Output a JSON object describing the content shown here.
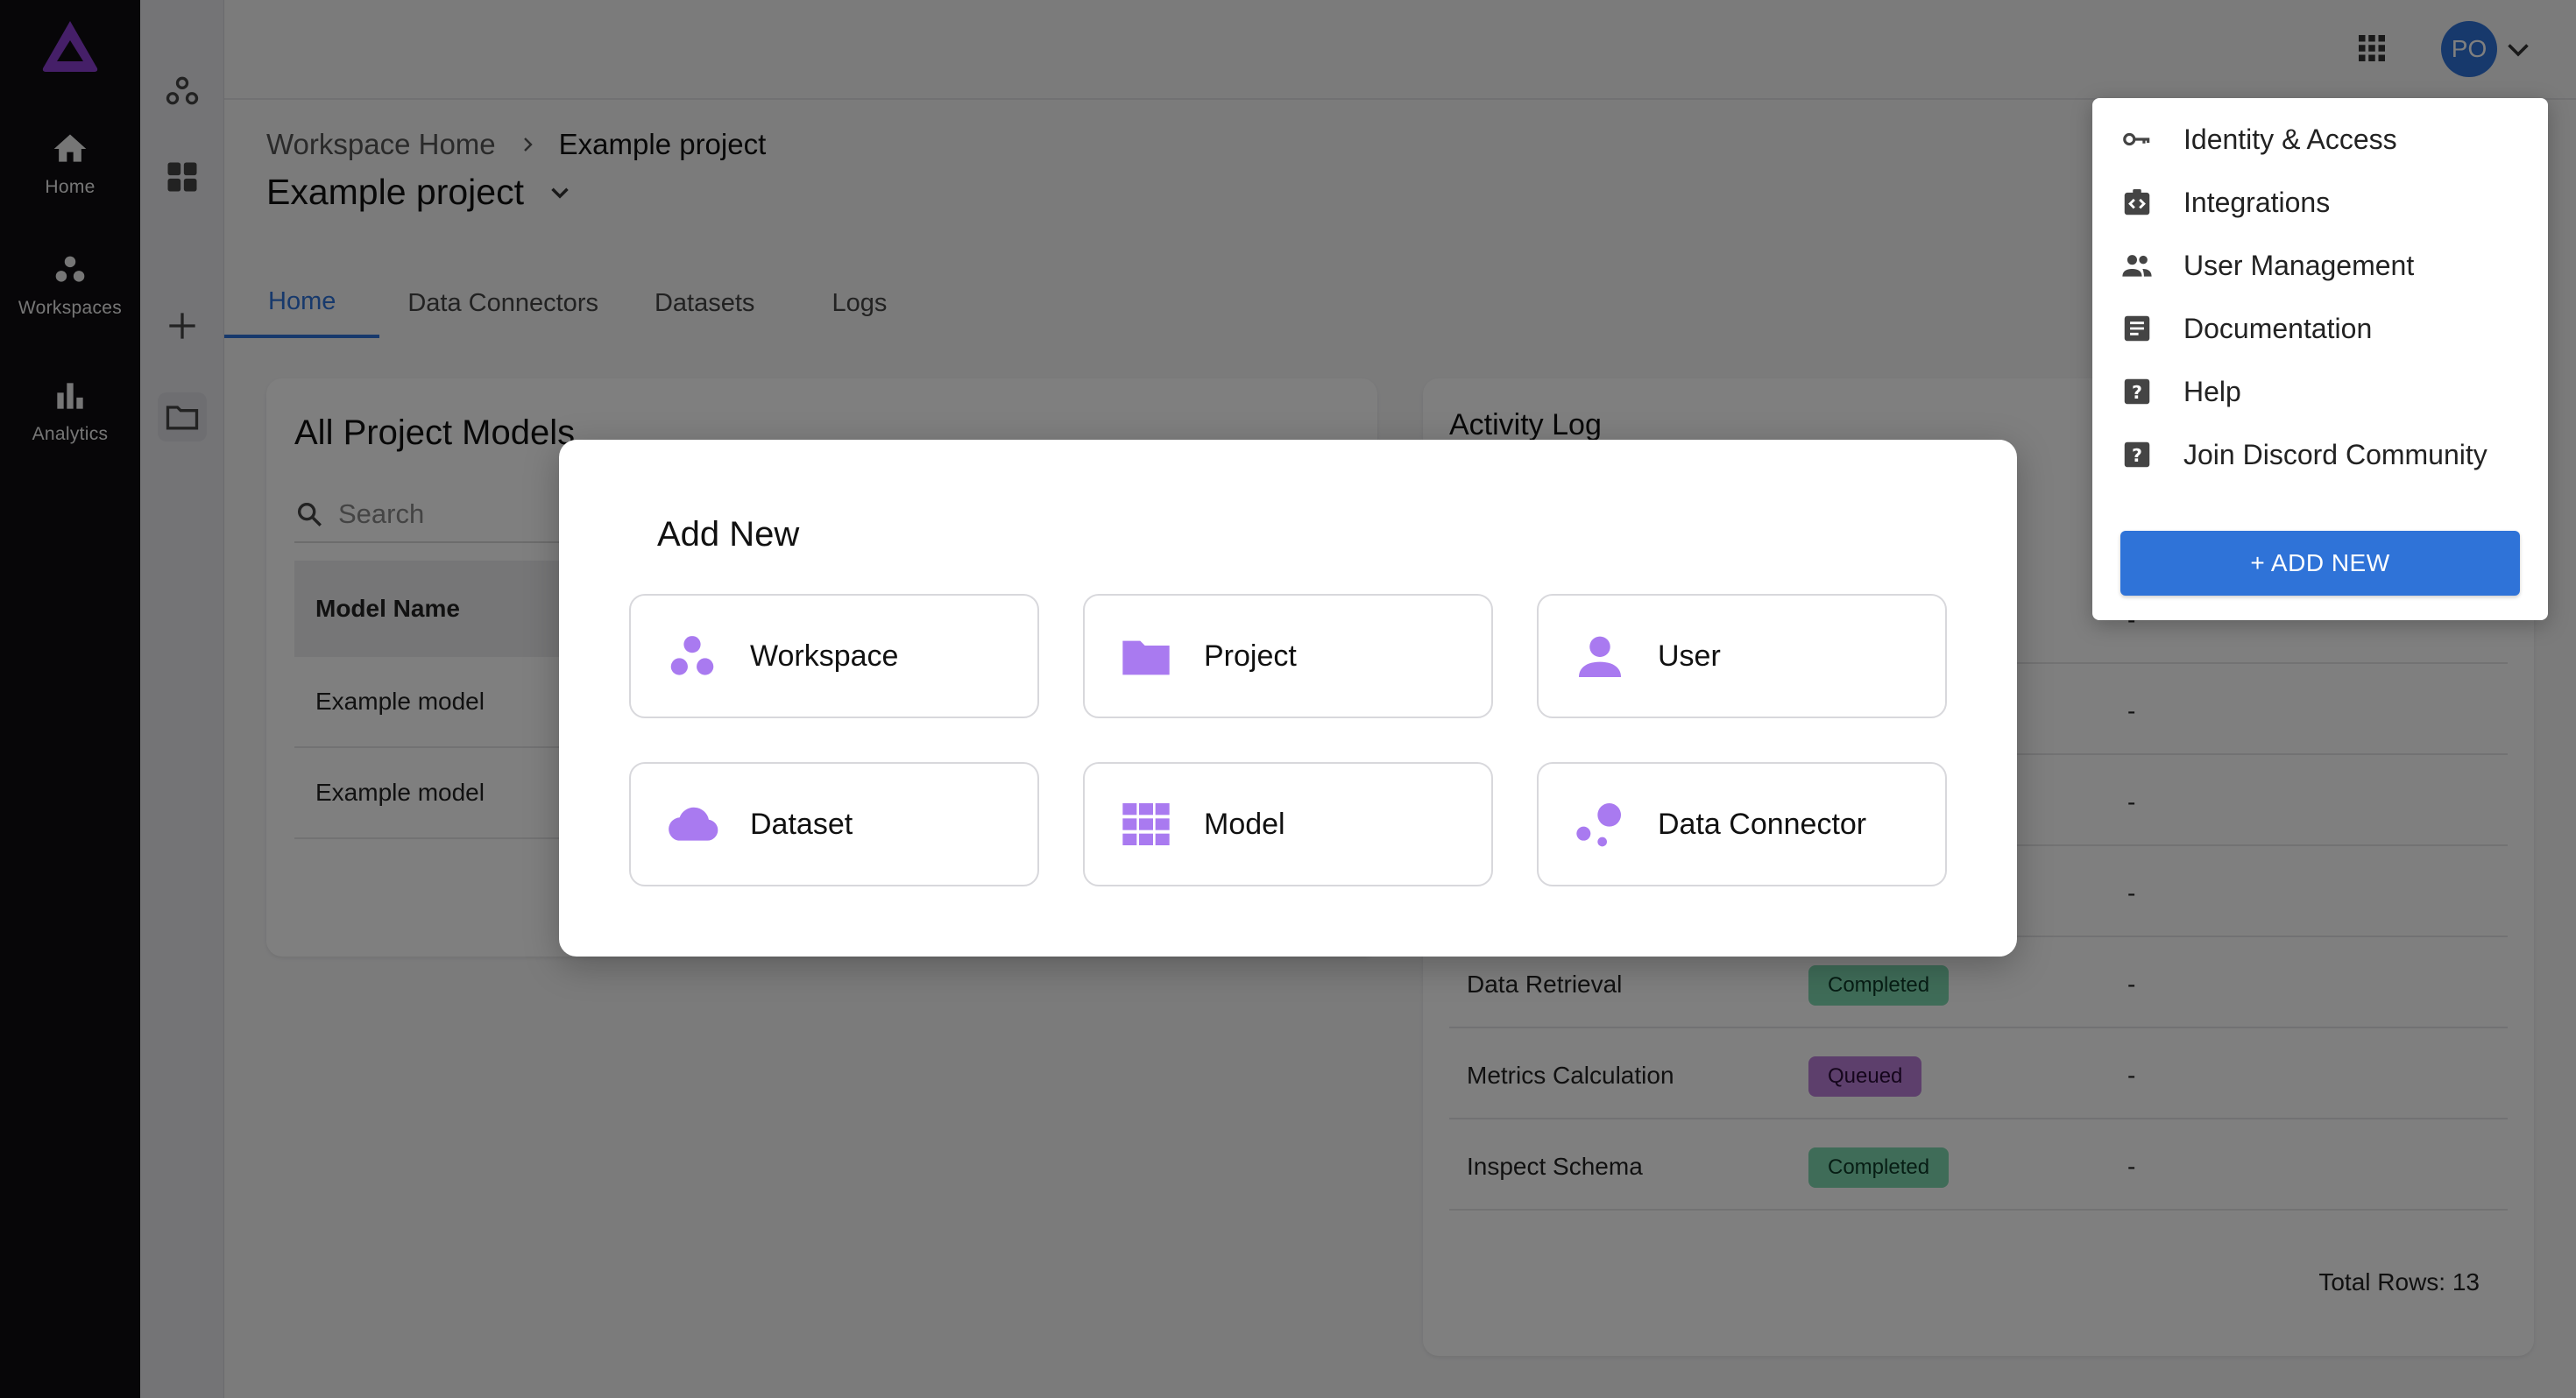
{
  "colors": {
    "accent": "#2f73d8",
    "purple": "#a97af0",
    "completed": "#7ed8b0",
    "queued": "#bb7fd8"
  },
  "rail": {
    "items": [
      {
        "label": "Home",
        "icon": "home-icon"
      },
      {
        "label": "Workspaces",
        "icon": "workspaces-icon"
      },
      {
        "label": "Analytics",
        "icon": "analytics-icon"
      }
    ]
  },
  "topbar": {
    "avatar_initials": "PO"
  },
  "breadcrumb": {
    "parent": "Workspace Home",
    "current": "Example project"
  },
  "page": {
    "title": "Example project"
  },
  "tabs": [
    {
      "label": "Home"
    },
    {
      "label": "Data Connectors"
    },
    {
      "label": "Datasets"
    },
    {
      "label": "Logs"
    }
  ],
  "models": {
    "title": "All Project Models",
    "search_placeholder": "Search",
    "column_header": "Model Name",
    "rows": [
      "Example model",
      "Example model"
    ]
  },
  "activity": {
    "title": "Activity Log",
    "rows": [
      {
        "name": "",
        "status": "",
        "extra": "-"
      },
      {
        "name": "",
        "status": "",
        "extra": "-"
      },
      {
        "name": "",
        "status": "",
        "extra": "-"
      },
      {
        "name": "",
        "status": "",
        "extra": "-"
      },
      {
        "name": "Data Retrieval",
        "status": "Completed",
        "extra": "-"
      },
      {
        "name": "Metrics Calculation",
        "status": "Queued",
        "extra": "-"
      },
      {
        "name": "Inspect Schema",
        "status": "Completed",
        "extra": "-"
      }
    ],
    "total_rows": "Total Rows: 13"
  },
  "modal": {
    "title": "Add New",
    "options": [
      {
        "label": "Workspace",
        "icon": "workspace-icon"
      },
      {
        "label": "Project",
        "icon": "folder-icon"
      },
      {
        "label": "User",
        "icon": "user-icon"
      },
      {
        "label": "Dataset",
        "icon": "cloud-icon"
      },
      {
        "label": "Model",
        "icon": "grid-icon"
      },
      {
        "label": "Data Connector",
        "icon": "data-connector-icon"
      }
    ]
  },
  "menu": {
    "items": [
      {
        "label": "Identity & Access",
        "icon": "key-icon"
      },
      {
        "label": "Integrations",
        "icon": "integrations-icon"
      },
      {
        "label": "User Management",
        "icon": "users-icon"
      },
      {
        "label": "Documentation",
        "icon": "document-icon"
      },
      {
        "label": "Help",
        "icon": "help-icon"
      },
      {
        "label": "Join Discord Community",
        "icon": "help-icon"
      }
    ],
    "add_new_label": "+ ADD NEW"
  }
}
